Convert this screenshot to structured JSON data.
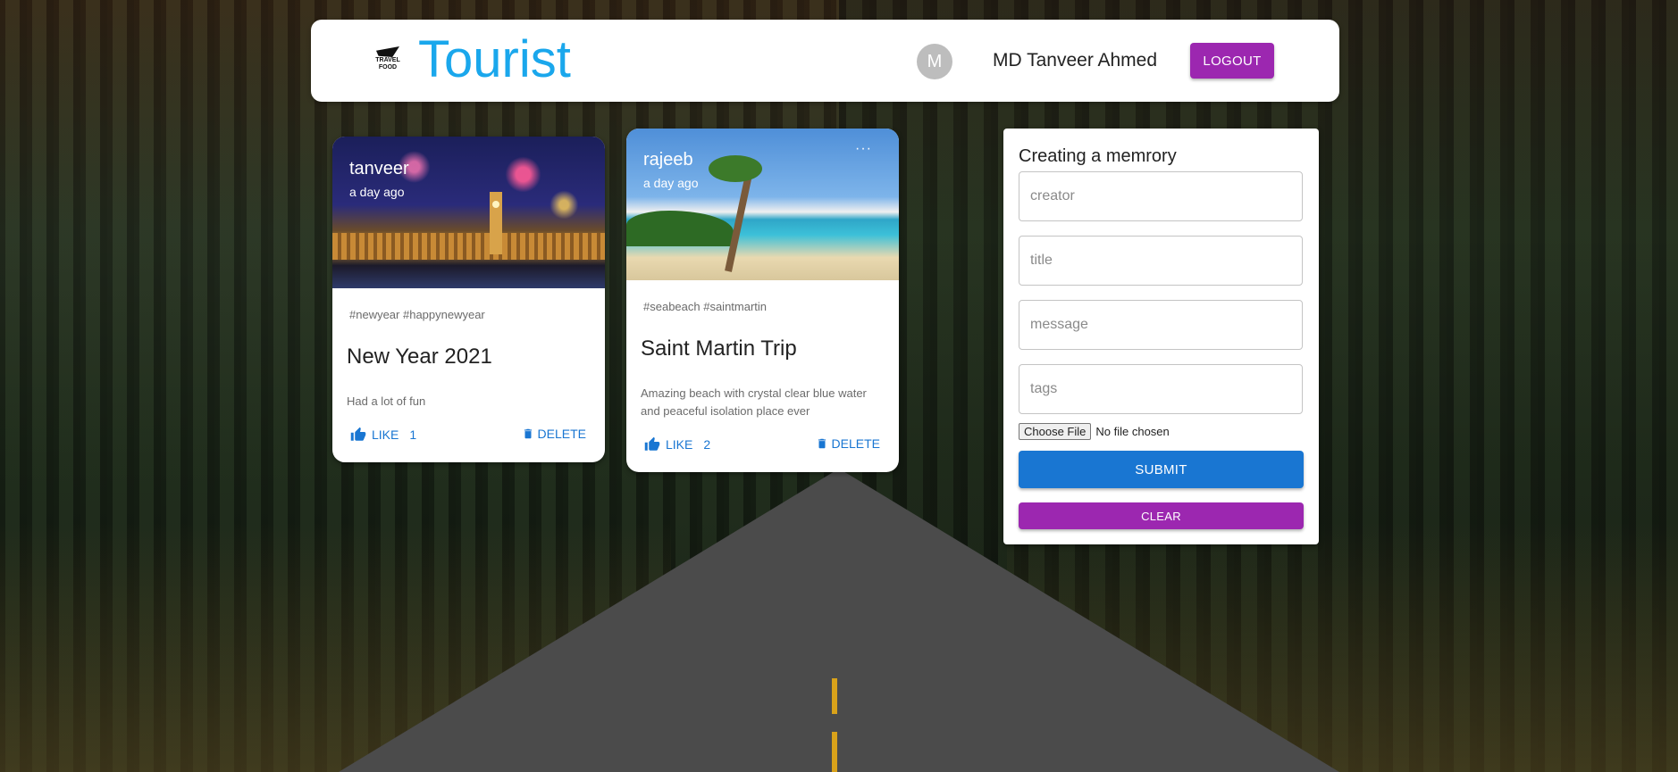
{
  "header": {
    "logo_text": "TRAVEL FOOD",
    "brand": "Tourist",
    "avatar_letter": "M",
    "username": "MD Tanveer Ahmed",
    "logout_label": "LOGOUT"
  },
  "posts": [
    {
      "creator": "tanveer",
      "time": "a day ago",
      "tags": "#newyear #happynewyear",
      "title": "New Year 2021",
      "message": "Had a lot of fun",
      "like_label": "LIKE",
      "like_count": "1",
      "delete_label": "DELETE"
    },
    {
      "creator": "rajeeb",
      "time": "a day ago",
      "more_label": "···",
      "tags": "#seabeach #saintmartin",
      "title": "Saint Martin Trip",
      "message": "Amazing beach with crystal clear blue water and peaceful isolation place ever",
      "like_label": "LIKE",
      "like_count": "2",
      "delete_label": "DELETE"
    }
  ],
  "form": {
    "heading": "Creating a memrory",
    "creator_placeholder": "creator",
    "title_placeholder": "title",
    "message_placeholder": "message",
    "tags_placeholder": "tags",
    "file_button": "Choose File",
    "file_status": "No file chosen",
    "submit_label": "SUBMIT",
    "clear_label": "CLEAR"
  },
  "colors": {
    "brand": "#1aa7ec",
    "primary": "#1976d2",
    "secondary": "#9c27b0"
  }
}
